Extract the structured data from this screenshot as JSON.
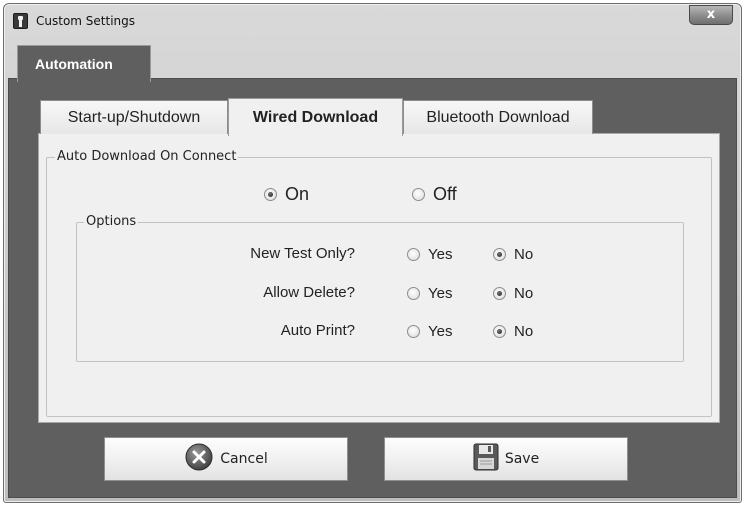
{
  "window": {
    "title": "Custom Settings",
    "close_label": "x"
  },
  "outer_tab": {
    "label": "Automation"
  },
  "inner_tabs": [
    {
      "label": "Start-up/Shutdown",
      "active": false
    },
    {
      "label": "Wired Download",
      "active": true
    },
    {
      "label": "Bluetooth Download",
      "active": false
    }
  ],
  "auto_download": {
    "legend": "Auto Download On Connect",
    "on_label": "On",
    "off_label": "Off",
    "selected": "On"
  },
  "options": {
    "legend": "Options",
    "rows": [
      {
        "label": "New Test Only?",
        "yes_label": "Yes",
        "no_label": "No",
        "selected": "No"
      },
      {
        "label": "Allow Delete?",
        "yes_label": "Yes",
        "no_label": "No",
        "selected": "No"
      },
      {
        "label": "Auto Print?",
        "yes_label": "Yes",
        "no_label": "No",
        "selected": "No"
      }
    ]
  },
  "buttons": {
    "cancel_label": "Cancel",
    "cancel_icon": "cancel-x-icon",
    "save_label": "Save",
    "save_icon": "floppy-disk-icon"
  },
  "colors": {
    "dark_panel": "#5f5f5f",
    "light_panel": "#f0f0f0"
  }
}
